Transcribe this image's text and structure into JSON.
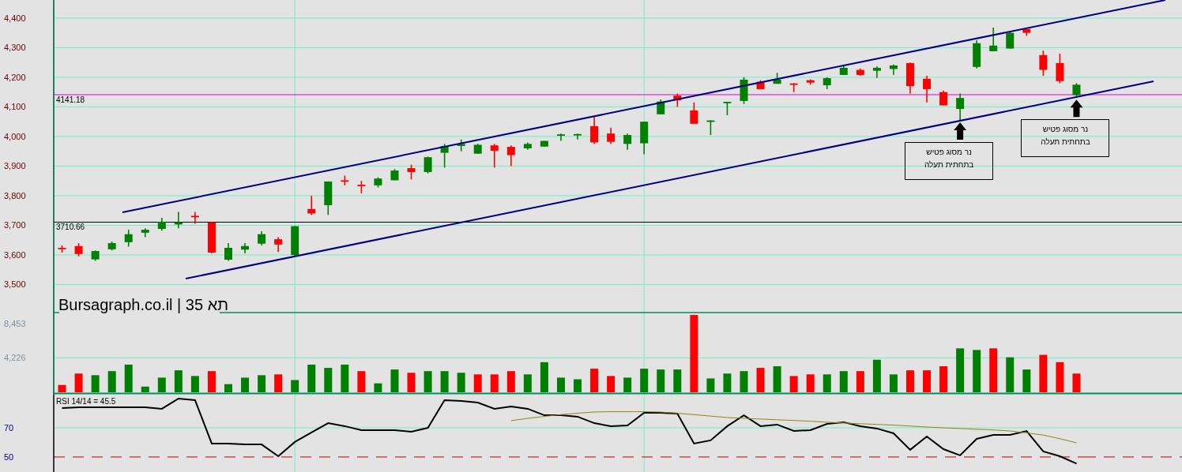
{
  "title": "Bursagraph.co.il | תא 35",
  "price": {
    "chart_data": {
      "type": "candlestick",
      "grid": true,
      "ylim": [
        3408,
        4461
      ],
      "categories": [
        null,
        null,
        null,
        null,
        null,
        null,
        null,
        null,
        null,
        null,
        null,
        null,
        null,
        null,
        null,
        null,
        null,
        null,
        null,
        null,
        null,
        null,
        null,
        null,
        null,
        null,
        null,
        null,
        null,
        null,
        null,
        null,
        null,
        null,
        null,
        null,
        null,
        null,
        null,
        null,
        null,
        null,
        null,
        null,
        null,
        null,
        null,
        null,
        null,
        null,
        null,
        null,
        null,
        null,
        null,
        null,
        null,
        null,
        null,
        null,
        null,
        null
      ],
      "yticks": [
        {
          "value": 3500,
          "label": "3,500"
        },
        {
          "value": 3600,
          "label": "3,600"
        },
        {
          "value": 3700,
          "label": "3,700"
        },
        {
          "value": 3800,
          "label": "3,800"
        },
        {
          "value": 3900,
          "label": "3,900"
        },
        {
          "value": 4000,
          "label": "4,000"
        },
        {
          "value": 4100,
          "label": "4,100"
        },
        {
          "value": 4200,
          "label": "4,200"
        },
        {
          "value": 4300,
          "label": "4,300"
        },
        {
          "value": 4400,
          "label": "4,400"
        }
      ],
      "ohlc": [
        [
          3622,
          3632,
          3608,
          3618
        ],
        [
          3630,
          3640,
          3595,
          3603
        ],
        [
          3585,
          3615,
          3580,
          3613
        ],
        [
          3619,
          3645,
          3615,
          3640
        ],
        [
          3643,
          3685,
          3628,
          3670
        ],
        [
          3675,
          3690,
          3660,
          3685
        ],
        [
          3688,
          3725,
          3682,
          3712
        ],
        [
          3703,
          3745,
          3690,
          3710
        ],
        [
          3730,
          3745,
          3705,
          3727
        ],
        [
          3710,
          3712,
          3605,
          3608
        ],
        [
          3584,
          3640,
          3580,
          3624
        ],
        [
          3618,
          3640,
          3605,
          3630
        ],
        [
          3638,
          3680,
          3632,
          3670
        ],
        [
          3653,
          3660,
          3610,
          3635
        ],
        [
          3600,
          3698,
          3595,
          3697
        ],
        [
          3755,
          3800,
          3735,
          3740
        ],
        [
          3768,
          3848,
          3735,
          3848
        ],
        [
          3850,
          3868,
          3835,
          3847
        ],
        [
          3835,
          3850,
          3808,
          3832
        ],
        [
          3835,
          3862,
          3828,
          3858
        ],
        [
          3852,
          3890,
          3852,
          3885
        ],
        [
          3893,
          3905,
          3855,
          3880
        ],
        [
          3880,
          3932,
          3875,
          3930
        ],
        [
          3945,
          3975,
          3895,
          3968
        ],
        [
          3968,
          3990,
          3950,
          3975
        ],
        [
          3942,
          3975,
          3942,
          3972
        ],
        [
          3970,
          3975,
          3895,
          3952
        ],
        [
          3965,
          3970,
          3900,
          3937
        ],
        [
          3960,
          3980,
          3955,
          3975
        ],
        [
          3966,
          3985,
          3966,
          3985
        ],
        [
          4003,
          4010,
          3985,
          4005
        ],
        [
          4003,
          4010,
          3990,
          4006
        ],
        [
          4035,
          4070,
          3975,
          3980
        ],
        [
          4010,
          4030,
          3975,
          3982
        ],
        [
          3975,
          4010,
          3955,
          4005
        ],
        [
          3977,
          4050,
          3940,
          4050
        ],
        [
          4075,
          4125,
          4075,
          4118
        ],
        [
          4138,
          4145,
          4100,
          4122
        ],
        [
          4088,
          4115,
          4043,
          4043
        ],
        [
          4048,
          4055,
          4005,
          4052
        ],
        [
          4110,
          4115,
          4072,
          4115
        ],
        [
          4120,
          4200,
          4110,
          4192
        ],
        [
          4185,
          4190,
          4160,
          4160
        ],
        [
          4178,
          4215,
          4178,
          4192
        ],
        [
          4177,
          4180,
          4150,
          4175
        ],
        [
          4190,
          4193,
          4175,
          4182
        ],
        [
          4173,
          4200,
          4160,
          4197
        ],
        [
          4208,
          4240,
          4208,
          4232
        ],
        [
          4225,
          4230,
          4205,
          4208
        ],
        [
          4222,
          4237,
          4198,
          4232
        ],
        [
          4228,
          4243,
          4208,
          4240
        ],
        [
          4248,
          4250,
          4145,
          4170
        ],
        [
          4195,
          4205,
          4115,
          4160
        ],
        [
          4150,
          4155,
          4105,
          4105
        ],
        [
          4093,
          4145,
          4053,
          4130
        ],
        [
          4235,
          4325,
          4230,
          4315
        ],
        [
          4288,
          4368,
          4288,
          4307
        ],
        [
          4297,
          4352,
          4297,
          4350
        ],
        [
          4363,
          4365,
          4340,
          4350
        ],
        [
          4275,
          4290,
          4205,
          4225
        ],
        [
          4248,
          4280,
          4180,
          4187
        ],
        [
          4140,
          4180,
          4130,
          4175
        ]
      ],
      "ref_lines": [
        {
          "axis": "y",
          "value": 4141.18,
          "label": "4141.18",
          "color": "#e000e0"
        },
        {
          "axis": "y",
          "value": 3710.66,
          "label": "3710.66",
          "color": "#000000"
        }
      ],
      "annotations": [
        "נר מסוג פטיש בתחתית תעלה",
        "נר מסוג פטיש בתחתית תעלה"
      ]
    }
  },
  "volume": {
    "chart_data": {
      "type": "bar",
      "ylim": [
        0,
        9700
      ],
      "ref_lines": [
        {
          "axis": "y",
          "value": 4226,
          "color": "#70f0c8"
        }
      ],
      "categories": [
        null,
        null,
        null,
        null,
        null,
        null,
        null,
        null,
        null,
        null,
        null,
        null,
        null,
        null,
        null,
        null,
        null,
        null,
        null,
        null,
        null,
        null,
        null,
        null,
        null,
        null,
        null,
        null,
        null,
        null,
        null,
        null,
        null,
        null,
        null,
        null,
        null,
        null,
        null,
        null,
        null,
        null,
        null,
        null,
        null,
        null,
        null,
        null,
        null,
        null,
        null,
        null,
        null,
        null,
        null,
        null,
        null,
        null,
        null,
        null,
        null,
        null
      ],
      "yticks": [
        {
          "value": 4226,
          "label": "4,226"
        },
        {
          "value": 8453,
          "label": "8,453"
        }
      ],
      "series": [
        {
          "values": [
            900,
            2300,
            2100,
            2600,
            3400,
            700,
            1800,
            2700,
            2000,
            2600,
            1000,
            1800,
            2100,
            2200,
            1500,
            3400,
            3000,
            3400,
            2600,
            1100,
            2800,
            2400,
            2600,
            2600,
            2400,
            2200,
            2200,
            2600,
            2200,
            3700,
            1800,
            1600,
            2900,
            2000,
            1800,
            2900,
            2800,
            2800,
            9500,
            1700,
            2300,
            2600,
            3000,
            3200,
            2000,
            2200,
            2200,
            2600,
            2600,
            4000,
            2200,
            2700,
            2700,
            3200,
            5400,
            5200,
            5400,
            4300,
            2800,
            4600,
            3700,
            2300
          ],
          "colors": [
            "#ff0000",
            "#ff0000",
            "#008000",
            "#008000",
            "#008000",
            "#008000",
            "#008000",
            "#008000",
            "#008000",
            "#ff0000",
            "#008000",
            "#008000",
            "#008000",
            "#ff0000",
            "#008000",
            "#008000",
            "#008000",
            "#008000",
            "#ff0000",
            "#008000",
            "#008000",
            "#ff0000",
            "#008000",
            "#008000",
            "#008000",
            "#ff0000",
            "#ff0000",
            "#ff0000",
            "#008000",
            "#008000",
            "#008000",
            "#008000",
            "#ff0000",
            "#ff0000",
            "#008000",
            "#008000",
            "#008000",
            "#008000",
            "#ff0000",
            "#008000",
            "#008000",
            "#008000",
            "#ff0000",
            "#008000",
            "#ff0000",
            "#ff0000",
            "#008000",
            "#008000",
            "#ff0000",
            "#008000",
            "#008000",
            "#ff0000",
            "#ff0000",
            "#ff0000",
            "#008000",
            "#008000",
            "#ff0000",
            "#008000",
            "#008000",
            "#ff0000",
            "#ff0000",
            "#ff0000"
          ]
        }
      ]
    }
  },
  "rsi": {
    "label": "RSI 14/14 = 45.5",
    "chart_data": {
      "type": "line",
      "ylim": [
        39.7,
        92.7
      ],
      "ref_lines": [
        {
          "axis": "y",
          "value": 70,
          "color": "#70f0c8"
        },
        {
          "axis": "y",
          "value": 50,
          "color": "#c00000"
        }
      ],
      "categories": [
        null,
        null,
        null,
        null,
        null,
        null,
        null,
        null,
        null,
        null,
        null,
        null,
        null,
        null,
        null,
        null,
        null,
        null,
        null,
        null,
        null,
        null,
        null,
        null,
        null,
        null,
        null,
        null,
        null,
        null,
        null,
        null,
        null,
        null,
        null,
        null,
        null,
        null,
        null,
        null,
        null,
        null,
        null,
        null,
        null,
        null,
        null,
        null,
        null,
        null,
        null,
        null,
        null,
        null,
        null,
        null,
        null,
        null,
        null,
        null,
        null,
        null
      ],
      "yticks": [
        {
          "value": 50,
          "label": "50"
        },
        {
          "value": 70,
          "label": "70"
        }
      ],
      "series": [
        {
          "color": "#000000",
          "values": [
            83.5,
            84.1,
            84.1,
            84.1,
            84.1,
            84.1,
            83.0,
            90.0,
            88.9,
            59.2,
            59.2,
            58.6,
            58.6,
            50.5,
            60.3,
            66.8,
            73.2,
            71.1,
            68.4,
            68.4,
            68.4,
            67.3,
            70.0,
            88.9,
            88.4,
            87.3,
            83.0,
            84.6,
            83.0,
            78.6,
            78.6,
            77.6,
            73.2,
            71.1,
            71.6,
            80.3,
            80.3,
            79.7,
            59.2,
            61.4,
            71.1,
            78.6,
            71.1,
            72.2,
            67.8,
            68.4,
            72.7,
            73.8,
            71.1,
            69.5,
            66.2,
            54.9,
            64.1,
            55.4,
            51.1,
            62.4,
            65.1,
            65.1,
            67.8,
            53.8,
            50.5,
            45.5
          ]
        },
        {
          "color": "#8a8a10",
          "values": [
            null,
            null,
            null,
            null,
            null,
            null,
            null,
            null,
            null,
            null,
            null,
            null,
            null,
            null,
            null,
            null,
            null,
            null,
            null,
            null,
            null,
            null,
            null,
            null,
            null,
            null,
            null,
            74.9,
            76.5,
            77.8,
            79,
            80,
            80.8,
            81,
            81,
            81,
            80.8,
            80,
            79,
            78,
            77,
            76.5,
            76,
            75.5,
            75,
            74.5,
            73.8,
            73.3,
            72.8,
            72.3,
            71.8,
            71.2,
            70.5,
            70,
            69.5,
            69,
            68.5,
            67.8,
            66.5,
            65,
            62.5,
            59.7
          ]
        }
      ]
    }
  }
}
